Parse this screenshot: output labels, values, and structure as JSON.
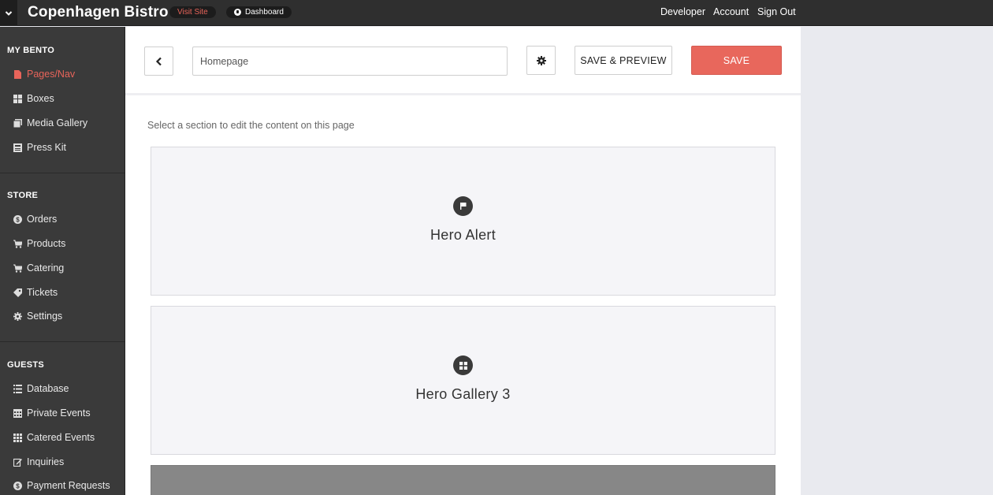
{
  "header": {
    "brand": "Copenhagen Bistro",
    "visit_site": "Visit Site",
    "dashboard": "Dashboard",
    "nav": [
      "Developer",
      "Account",
      "Sign Out"
    ]
  },
  "sidebar": {
    "sections": [
      {
        "title": "MY BENTO",
        "items": [
          {
            "label": "Pages/Nav",
            "icon": "page-icon",
            "active": true
          },
          {
            "label": "Boxes",
            "icon": "grid-icon"
          },
          {
            "label": "Media Gallery",
            "icon": "media-icon"
          },
          {
            "label": "Press Kit",
            "icon": "newspaper-icon"
          }
        ]
      },
      {
        "title": "STORE",
        "items": [
          {
            "label": "Orders",
            "icon": "dollar-icon"
          },
          {
            "label": "Products",
            "icon": "cart-icon"
          },
          {
            "label": "Catering",
            "icon": "cart-icon"
          },
          {
            "label": "Tickets",
            "icon": "tag-icon"
          },
          {
            "label": "Settings",
            "icon": "gear-icon"
          }
        ]
      },
      {
        "title": "GUESTS",
        "items": [
          {
            "label": "Database",
            "icon": "list-icon"
          },
          {
            "label": "Private Events",
            "icon": "calendar-icon"
          },
          {
            "label": "Catered Events",
            "icon": "calendar-grid-icon"
          },
          {
            "label": "Inquiries",
            "icon": "edit-icon"
          },
          {
            "label": "Payment Requests",
            "icon": "dollar-icon"
          }
        ]
      }
    ]
  },
  "editor": {
    "page_title_value": "Homepage",
    "save_preview_label": "SAVE & PREVIEW",
    "save_label": "SAVE",
    "hint": "Select a section to edit the content on this page",
    "sections": [
      {
        "label": "Hero Alert",
        "icon": "flag-icon"
      },
      {
        "label": "Hero Gallery 3",
        "icon": "grid-icon"
      }
    ]
  },
  "colors": {
    "accent": "#e8645a",
    "topbar": "#2f2f2f",
    "sidebar": "#3a3a3a"
  }
}
